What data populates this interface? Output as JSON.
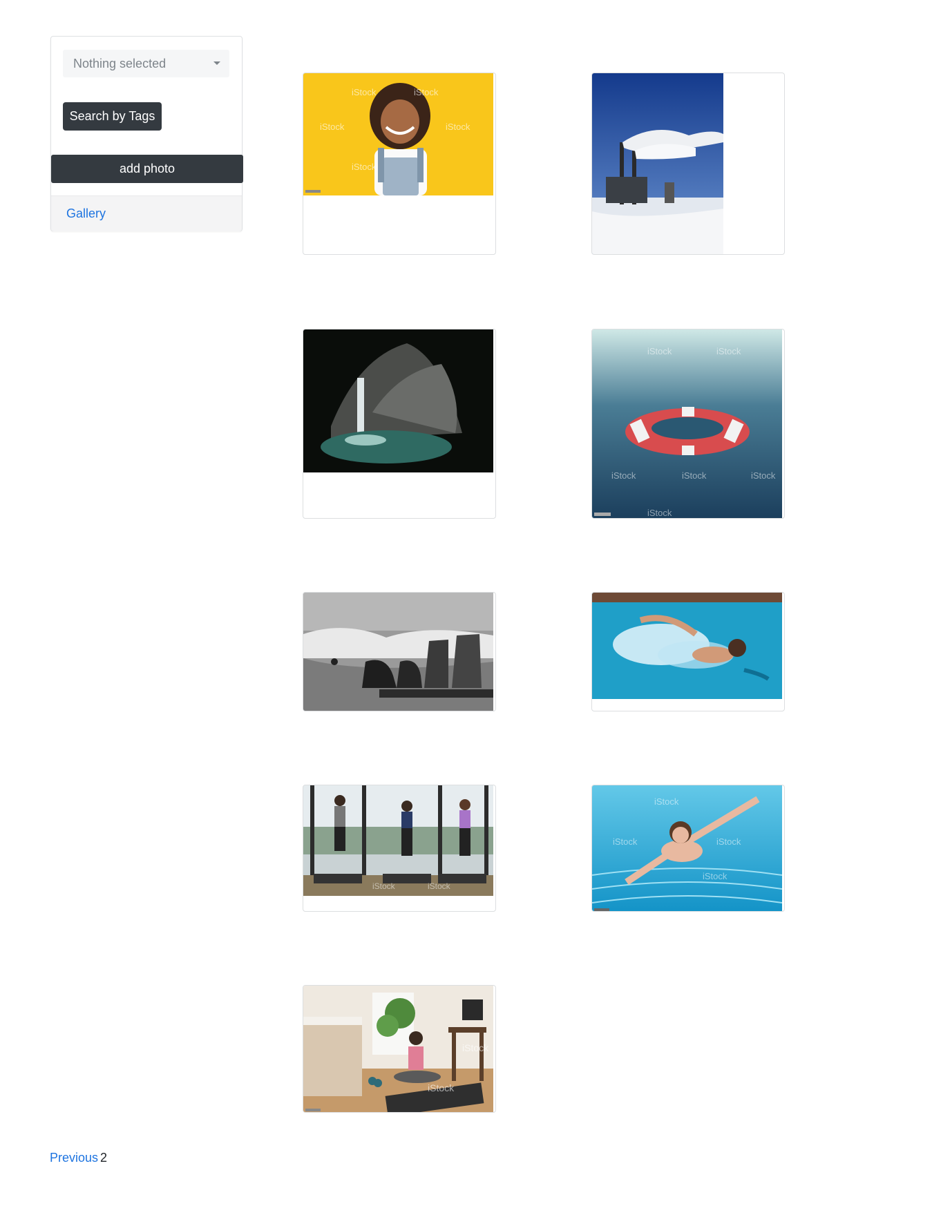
{
  "sidebar": {
    "tag_select": {
      "value": "Nothing selected"
    },
    "search_button": "Search by Tags",
    "add_button": "add photo",
    "footer_link": "Gallery"
  },
  "gallery": {
    "items": [
      {
        "subject": "smiling girl on yellow background",
        "watermark": "iStock"
      },
      {
        "subject": "factory chimneys with smoke over snow"
      },
      {
        "subject": "waterfall in a cave"
      },
      {
        "subject": "lifebuoy floating in the sea",
        "watermark": "iStock"
      },
      {
        "subject": "boots on a bench by the waves"
      },
      {
        "subject": "man swimming in a pool"
      },
      {
        "subject": "three women on treadmills",
        "watermark": "iStock"
      },
      {
        "subject": "child swimming underwater",
        "watermark": "iStock"
      },
      {
        "subject": "woman meditating on a yoga mat",
        "watermark": "iStock"
      }
    ]
  },
  "pagination": {
    "previous": "Previous",
    "page": "2"
  },
  "colors": {
    "dark_button": "#343a40",
    "link": "#1e74e0",
    "placeholder": "#7d848a"
  }
}
